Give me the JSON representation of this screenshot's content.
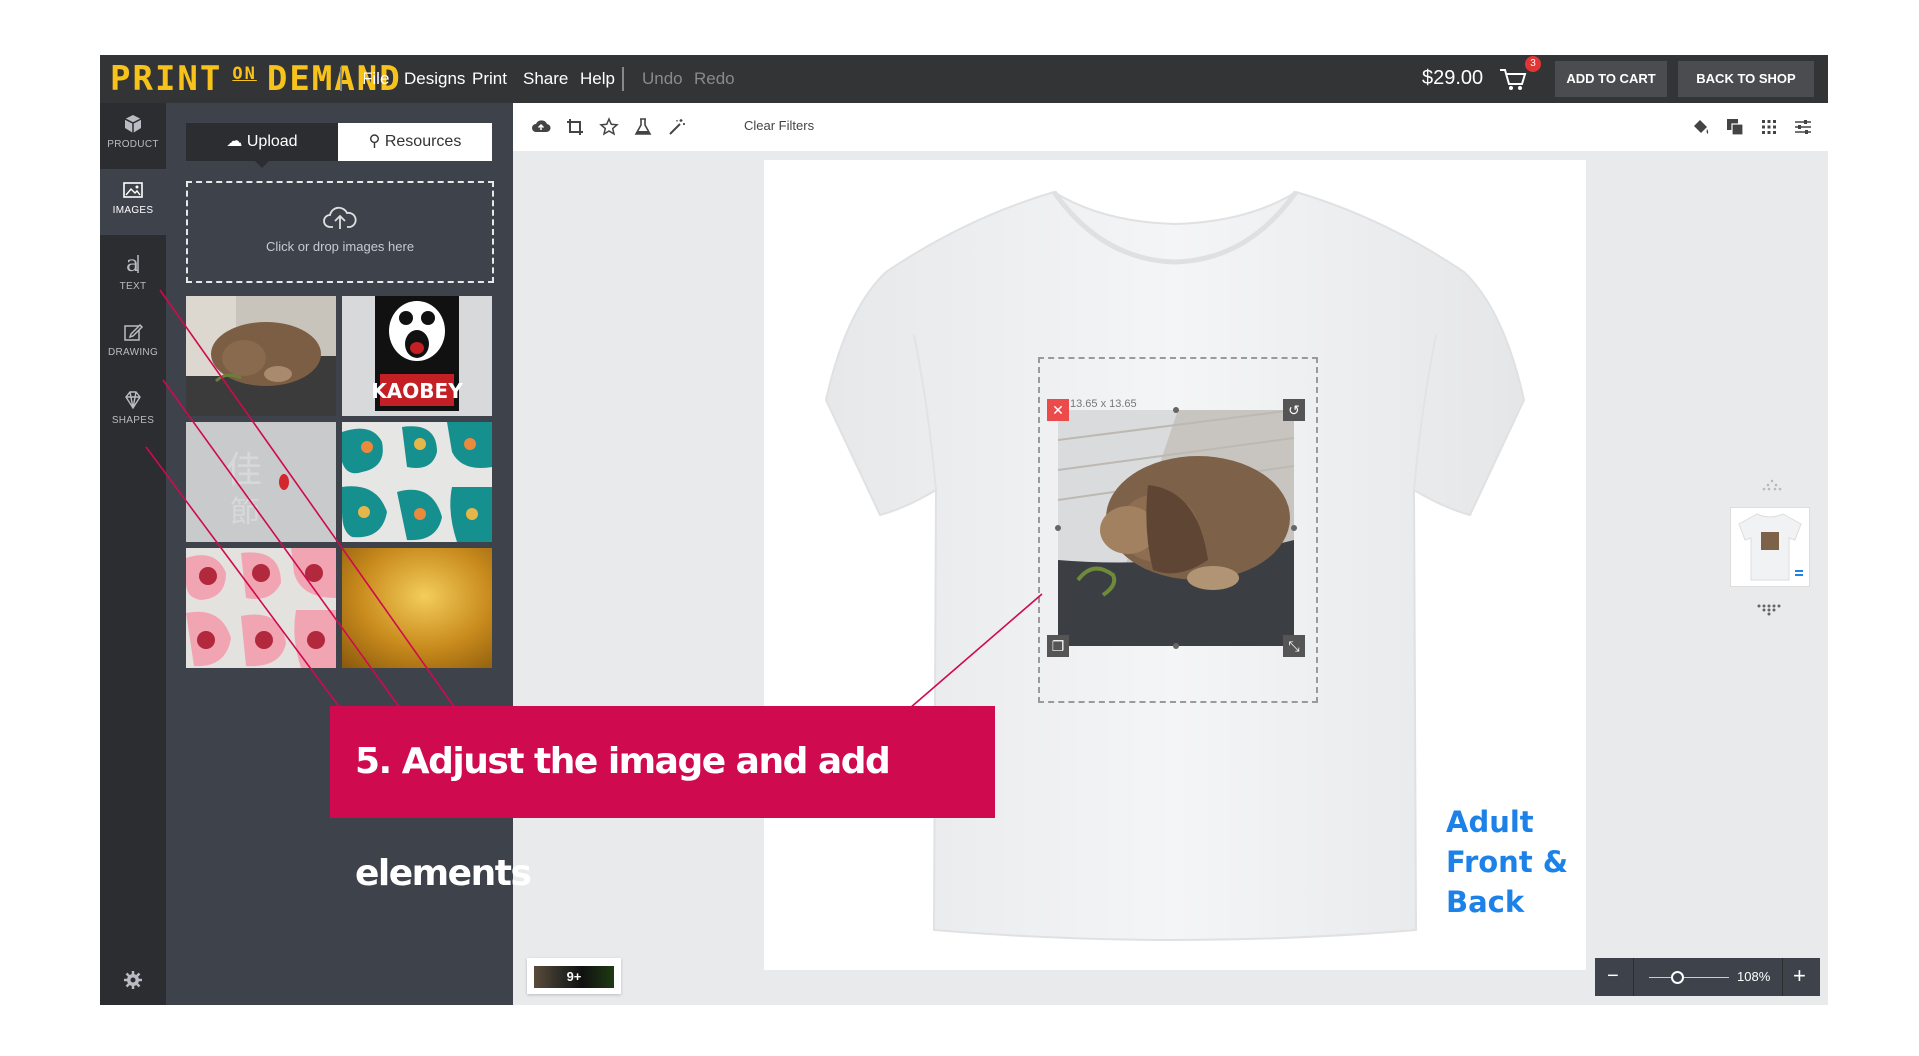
{
  "header": {
    "logo": {
      "left": "PRINT",
      "on": "ON",
      "right": "DEMAND"
    },
    "menu": [
      "File",
      "Designs",
      "Print",
      "Share",
      "Help"
    ],
    "undo": "Undo",
    "redo": "Redo",
    "price": "$29.00",
    "cart_count": "3",
    "add_to_cart": "ADD TO CART",
    "back_to_shop": "BACK TO SHOP"
  },
  "rail": {
    "items": [
      {
        "label": "PRODUCT",
        "icon": "cube-icon"
      },
      {
        "label": "IMAGES",
        "icon": "image-icon"
      },
      {
        "label": "TEXT",
        "icon": "text-icon"
      },
      {
        "label": "DRAWING",
        "icon": "pencil-icon"
      },
      {
        "label": "SHAPES",
        "icon": "diamond-icon"
      }
    ]
  },
  "panel": {
    "tabs": {
      "upload": "Upload",
      "resources": "Resources"
    },
    "dropzone": "Click or drop images here",
    "thumbnails": [
      "rabbit-photo",
      "kaobey-graphic",
      "pale-pattern",
      "teal-floral-pattern",
      "pink-floral-pattern",
      "gold-texture"
    ],
    "kaobey_text": "KAOBEY"
  },
  "toolbar": {
    "clear_filters": "Clear Filters",
    "icons": [
      "upload-cloud-icon",
      "crop-icon",
      "star-icon",
      "flask-icon",
      "magic-wand-icon"
    ],
    "right_icons": [
      "paint-bucket-icon",
      "layers-icon",
      "grid-icon",
      "sliders-icon"
    ]
  },
  "canvas": {
    "dimensions": "13.65 x 13.65",
    "product_label": [
      "Adult",
      "Front &",
      "Back"
    ]
  },
  "bottom": {
    "layers_count": "9+",
    "zoom_percent": "108%",
    "zoom_level": 0.35
  },
  "tutorial": {
    "callout": "5. Adjust the image and add elements",
    "accent": "#cf0a4f"
  },
  "colors": {
    "topbar": "#333436",
    "logo": "#f7c31a",
    "panel": "#3e434b",
    "product_label": "#1c82e8"
  }
}
